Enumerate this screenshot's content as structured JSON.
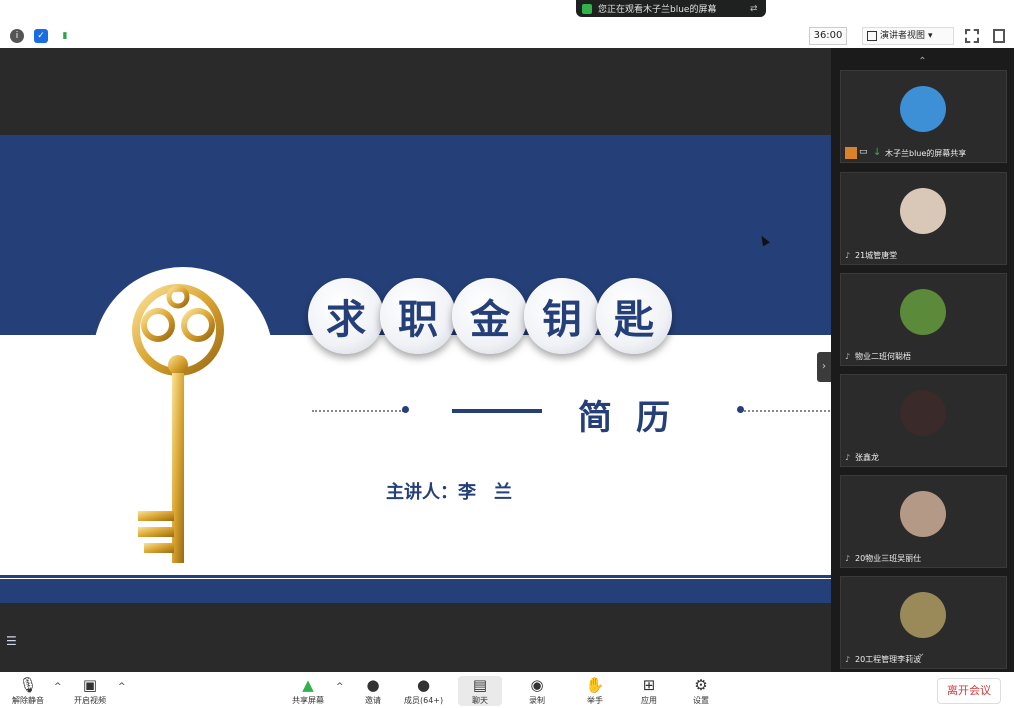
{
  "banner": {
    "text": "您正在观看木子兰blue的屏幕",
    "options_icon": "options-icon"
  },
  "topbar": {
    "timer": "36:00",
    "view_label": "演讲者视图",
    "view_caret": "▾"
  },
  "slide": {
    "title_chars": [
      "求",
      "职",
      "金",
      "钥",
      "匙"
    ],
    "subtitle": "简历",
    "presenter": "主讲人：李　兰"
  },
  "participants": [
    {
      "name": "木子兰blue的屏幕共享",
      "avatar_color": "#3d8fd6",
      "sharing": true
    },
    {
      "name": "21城管唐堂",
      "avatar_color": "#d9c8b8"
    },
    {
      "name": "物业二班何聪梧",
      "avatar_color": "#5b8a3a"
    },
    {
      "name": "张鑫龙",
      "avatar_color": "#3a2a2a"
    },
    {
      "name": "20物业三班吴丽仕",
      "avatar_color": "#b49a86"
    },
    {
      "name": "20工程管理李莉波",
      "avatar_color": "#9a8a5a"
    }
  ],
  "toolbar": {
    "mute": "解除静音",
    "video": "开启视频",
    "share": "共享屏幕",
    "invite": "邀请",
    "members": "成员(64+)",
    "chat": "聊天",
    "record": "录制",
    "raise": "举手",
    "apps": "应用",
    "settings": "设置",
    "leave": "离开会议"
  },
  "colors": {
    "slide_blue": "#253f78",
    "leave_red": "#d23c3c",
    "banner_green": "#2fb34a"
  }
}
